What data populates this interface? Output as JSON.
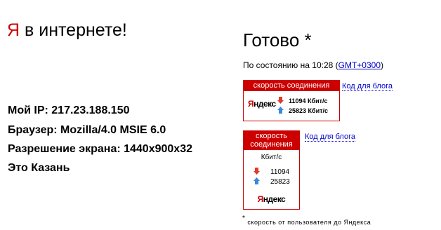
{
  "header": {
    "ya": "Я",
    "rest": " в интернете!"
  },
  "info": {
    "ip": "Мой IP: 217.23.188.150",
    "browser": "Браузер: Mozilla/4.0 MSIE 6.0",
    "resolution": "Разрешение экрана: 1440x900x32",
    "city": "Это Казань"
  },
  "status": {
    "title": "Готово *",
    "time_prefix": "По состоянию на 10:28  (",
    "tz": "GMT+0300",
    "time_suffix": ")"
  },
  "widget_wide": {
    "header": "скорость соединения",
    "logo_first": "Я",
    "logo_rest": "ндекс",
    "download": "11094 Кбит/с",
    "upload": "25823 Кбит/с",
    "blog_link": "Код для блога"
  },
  "widget_tall": {
    "header_line1": "скорость",
    "header_line2": "соединения",
    "unit": "Кбит/с",
    "download": "11094",
    "upload": "25823",
    "logo_first": "Я",
    "logo_rest": "ндекс",
    "blog_link": "Код для блога"
  },
  "footnote": {
    "star": "*",
    "text": " скорость от пользователя до Яндекса"
  },
  "colors": {
    "brand_red": "#cc0000",
    "link_blue": "#0000cc",
    "arrow_red": "#e2392b",
    "arrow_blue": "#3a8ad9"
  },
  "icons": {
    "down": "arrow-down-icon",
    "up": "arrow-up-icon"
  }
}
